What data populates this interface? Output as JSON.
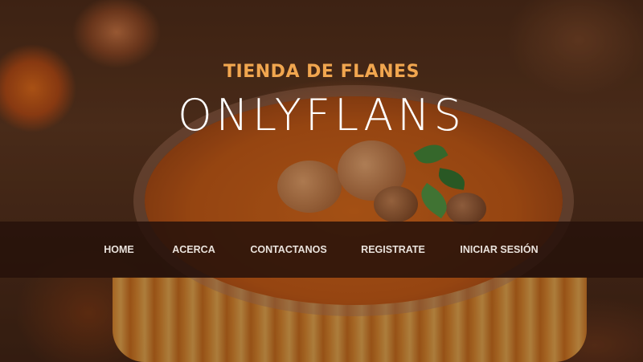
{
  "hero": {
    "subtitle": "TIENDA DE FLANES",
    "title": "ONLYFLANS"
  },
  "nav": {
    "items": [
      {
        "label": "HOME"
      },
      {
        "label": "ACERCA"
      },
      {
        "label": "CONTACTANOS"
      },
      {
        "label": "REGISTRATE"
      },
      {
        "label": "INICIAR SESIÓN"
      }
    ]
  },
  "colors": {
    "subtitle": "#f1a64f",
    "title": "#ffffff",
    "navbar_bg": "#26120a",
    "nav_text": "#e9e2dc"
  }
}
